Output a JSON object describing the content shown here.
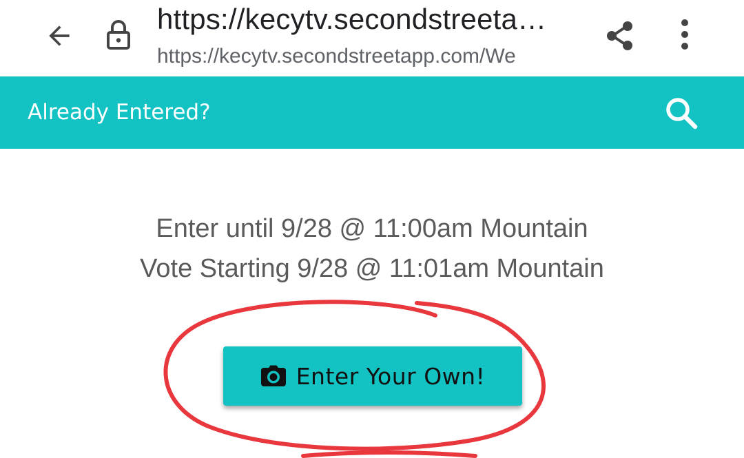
{
  "browser": {
    "title": "https://kecytv.secondstreeta…",
    "url": "https://kecytv.secondstreetapp.com/We",
    "icons": {
      "back": "arrow-back-icon",
      "lock": "lock-icon",
      "share": "share-icon",
      "menu": "more-vert-icon"
    }
  },
  "header": {
    "already_entered": "Already Entered?",
    "background": "#13c3c3",
    "search_icon": "search-icon"
  },
  "contest": {
    "enter_until": "Enter until 9/28 @ 11:00am Mountain",
    "vote_starting": "Vote Starting 9/28 @ 11:01am Mountain",
    "enter_button_label": "Enter Your Own!",
    "enter_button_icon": "camera-icon"
  },
  "colors": {
    "accent": "#13c3c3",
    "annotation": "#e8383d"
  }
}
